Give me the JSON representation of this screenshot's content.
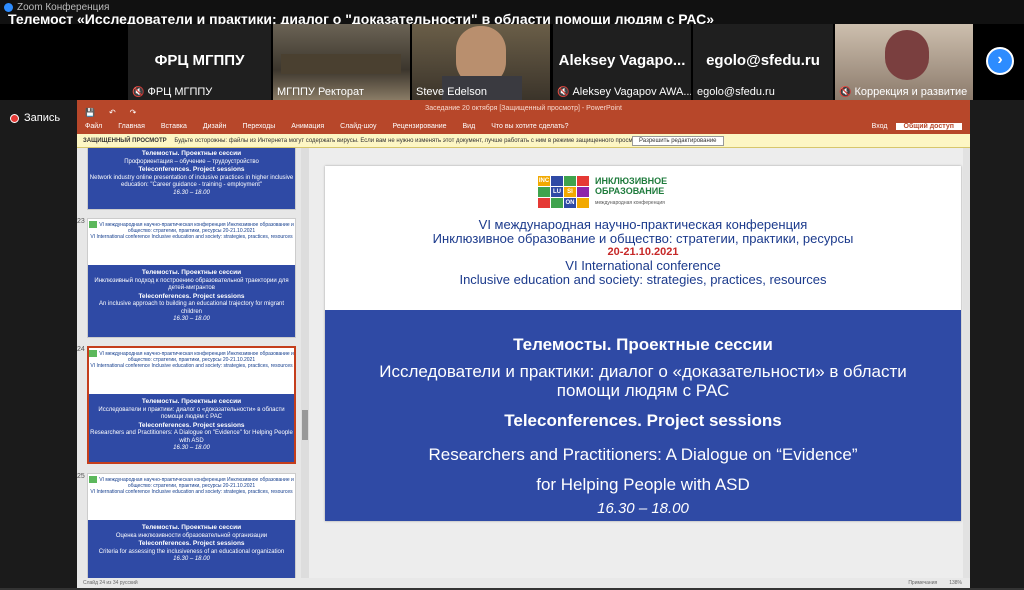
{
  "app": {
    "name": "Zoom Конференция"
  },
  "meeting_title": "Телемост «Исследователи и практики: диалог о \"доказательности\" в области помощи людям с РАС»",
  "participants": [
    {
      "display_name": "ФРЦ МГППУ",
      "label": "ФРЦ МГППУ",
      "muted": true,
      "video": false
    },
    {
      "display_name": "",
      "label": "МГППУ Ректорат",
      "muted": false,
      "video": true
    },
    {
      "display_name": "",
      "label": "Steve Edelson",
      "muted": false,
      "video": true
    },
    {
      "display_name": "Aleksey Vagapo...",
      "label": "Aleksey Vagapov AWA...",
      "muted": true,
      "video": false
    },
    {
      "display_name": "egolo@sfedu.ru",
      "label": "egolo@sfedu.ru",
      "muted": false,
      "video": false
    },
    {
      "display_name": "",
      "label": "Коррекция и развитие",
      "muted": true,
      "video": true
    }
  ],
  "recording_label": "Запись",
  "powerpoint": {
    "window_title": "Заседание 20 октября [Защищенный просмотр] - PowerPoint",
    "ribbon_tabs": [
      "Файл",
      "Главная",
      "Вставка",
      "Дизайн",
      "Переходы",
      "Анимация",
      "Слайд-шоу",
      "Рецензирование",
      "Вид",
      "Что вы хотите сделать?"
    ],
    "signin": "Вход",
    "share": "Общий доступ",
    "protected_title": "ЗАЩИЩЕННЫЙ ПРОСМОТР",
    "protected_text": "Будьте осторожны: файлы из Интернета могут содержать вирусы. Если вам не нужно изменять этот документ, лучше работать с ним в режиме защищенного просмотра.",
    "enable_editing": "Разрешить редактирование",
    "status_left": "Слайд 24 из 34    русский",
    "status_notes": "Примечания",
    "status_zoom": "138%"
  },
  "thumbnails": [
    {
      "num": "",
      "conf": "",
      "conf_en": "",
      "ru_title": "Телемосты. Проектные сессии",
      "ru_topic": "Профориентация – обучение – трудоустройство",
      "en_title": "Teleconferences. Project sessions",
      "en_topic": "Network industry online presentation of inclusive practices in higher inclusive education: \"Career guidance - training - employment\"",
      "time": "16.30 – 18.00"
    },
    {
      "num": "23",
      "conf": "VI международная научно-практическая конференция Инклюзивное образование и общество: стратегии, практики, ресурсы 20-21.10.2021",
      "conf_en": "VI International conference Inclusive education and society: strategies, practices, resources",
      "ru_title": "Телемосты. Проектные сессии",
      "ru_topic": "Инклюзивный подход к построению образовательной траектории для детей-мигрантов",
      "en_title": "Teleconferences. Project sessions",
      "en_topic": "An inclusive approach to building an educational trajectory for migrant children",
      "time": "16.30 – 18.00"
    },
    {
      "num": "24",
      "conf": "VI международная научно-практическая конференция Инклюзивное образование и общество: стратегии, практики, ресурсы 20-21.10.2021",
      "conf_en": "VI International conference Inclusive education and society: strategies, practices, resources",
      "ru_title": "Телемосты. Проектные сессии",
      "ru_topic": "Исследователи и практики: диалог о «доказательности» в области помощи людям с РАС",
      "en_title": "Teleconferences. Project sessions",
      "en_topic": "Researchers and Practitioners: A Dialogue on \"Evidence\" for Helping People with ASD",
      "time": "16.30 – 18.00"
    },
    {
      "num": "25",
      "conf": "VI международная научно-практическая конференция Инклюзивное образование и общество: стратегии, практики, ресурсы 20-21.10.2021",
      "conf_en": "VI International conference Inclusive education and society: strategies, practices, resources",
      "ru_title": "Телемосты. Проектные сессии",
      "ru_topic": "Оценка инклюзивности образовательной организации",
      "en_title": "Teleconferences. Project sessions",
      "en_topic": "Criteria for assessing the inclusiveness of an educational organization",
      "time": "16.30 – 18.00"
    }
  ],
  "slide": {
    "logo_letters": [
      "INC",
      "LU",
      "SI",
      "ON"
    ],
    "logo_text_1": "ИНКЛЮЗИВНОЕ",
    "logo_text_2": "ОБРАЗОВАНИЕ",
    "logo_sub": "международная конференция",
    "conf_ru_1": "VI международная научно-практическая конференция",
    "conf_ru_2": "Инклюзивное образование и общество: стратегии, практики, ресурсы",
    "date": "20-21.10.2021",
    "conf_en_1": "VI International conference",
    "conf_en_2": "Inclusive education and society: strategies, practices, resources",
    "session_ru": "Телемосты. Проектные сессии",
    "topic_ru": "Исследователи и практики: диалог о «доказательности» в области помощи людям с РАС",
    "session_en": "Teleconferences. Project sessions",
    "topic_en_1": "Researchers and Practitioners: A Dialogue on “Evidence”",
    "topic_en_2": "for Helping People with ASD",
    "time": "16.30 – 18.00"
  },
  "colors": {
    "ppt_accent": "#b7472a",
    "slide_blue": "#2f4aa5",
    "zoom_blue": "#2d8cff"
  }
}
